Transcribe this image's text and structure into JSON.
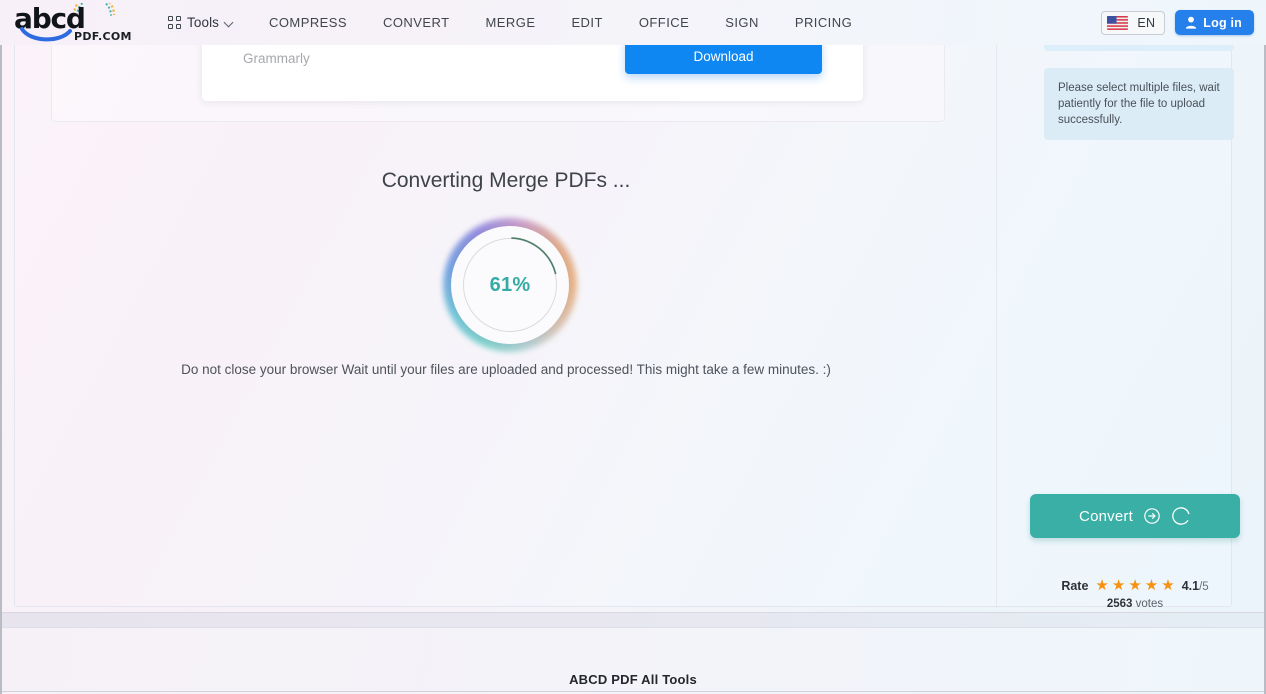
{
  "header": {
    "logo": {
      "text": "abcd",
      "sub": "PDF.COM",
      "icon": "abcd-pdf-logo"
    },
    "nav": [
      {
        "label": "Tools",
        "icon": "grid-icon",
        "chevron": "chevron-down-icon"
      },
      {
        "label": "COMPRESS"
      },
      {
        "label": "CONVERT"
      },
      {
        "label": "MERGE"
      },
      {
        "label": "EDIT"
      },
      {
        "label": "OFFICE"
      },
      {
        "label": "SIGN"
      },
      {
        "label": "PRICING"
      }
    ],
    "language": {
      "label": "EN",
      "icon": "us-flag-icon"
    },
    "login": {
      "label": "Log in",
      "icon": "user-icon"
    }
  },
  "ad": {
    "label": "Grammarly",
    "download_label": "Download",
    "button_color": "#0e87f2"
  },
  "main": {
    "title": "Converting Merge PDFs ...",
    "progress_percent": "61%",
    "progress_value": 61,
    "progress_color": "#35aba6",
    "note": "Do not close your browser Wait until your files are uploaded and processed! This might take a few minutes. :)"
  },
  "sidebar": {
    "info_text": "Please select multiple files, wait patiently for the file to upload successfully.",
    "info_bg": "#dbecf7",
    "convert": {
      "label": "Convert",
      "arrow_icon": "arrow-right-circle-icon",
      "spinner_icon": "loading-spinner-icon",
      "color": "#3aafa6"
    },
    "rating": {
      "label": "Rate",
      "stars": 5,
      "star_glyph": "★",
      "star_color": "#f79110",
      "score": "4.1",
      "out_of": "/5",
      "votes_count": "2563",
      "votes_label": "votes"
    }
  },
  "footer": {
    "title": "ABCD PDF All Tools"
  }
}
